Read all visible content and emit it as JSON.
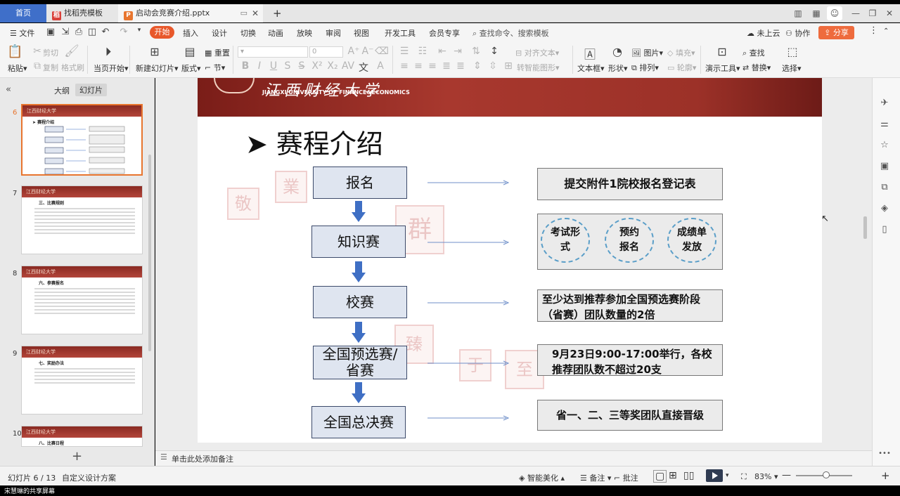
{
  "tabs": {
    "home": "首页",
    "template": "找稻壳模板",
    "doc": "启动会竞赛介绍.pptx",
    "add": "+"
  },
  "menu": {
    "file": "文件",
    "items": [
      "开始",
      "插入",
      "设计",
      "切换",
      "动画",
      "放映",
      "审阅",
      "视图",
      "开发工具",
      "会员专享"
    ],
    "search": "查找命令、搜索模板",
    "cloud": "未上云",
    "collab": "协作",
    "share": "分享"
  },
  "ribbon": {
    "paste": "粘贴",
    "cut": "剪切",
    "copy": "复制",
    "format_painter": "格式刷",
    "from_current": "当页开始",
    "new_slide": "新建幻灯片",
    "layout": "版式",
    "reset": "重置",
    "section": "节",
    "font_size": "0",
    "align_text": "对齐文本",
    "smart_shape": "转智能图形",
    "textbox": "文本框",
    "shape": "形状",
    "picture": "图片",
    "arrange": "排列",
    "fill": "填充",
    "outline": "轮廓",
    "present_tools": "演示工具",
    "find": "查找",
    "replace": "替换",
    "select": "选择"
  },
  "left_panel": {
    "outline_tab": "大纲",
    "slides_tab": "幻灯片",
    "slide_numbers": [
      "6",
      "7",
      "8",
      "9",
      "10"
    ],
    "thumb_titles": [
      "赛程介绍",
      "三、比赛规则",
      "六、参赛报名",
      "七、奖励办法",
      "八、比赛日程"
    ],
    "thumb_header": "江西财经大学"
  },
  "slide": {
    "banner_cn": "江西财经大学",
    "banner_en": "JIANGXI UNIVERSITY OF FINANCE&ECONOMICS",
    "title": "➤ 赛程介绍",
    "watermarks": [
      "敬",
      "業",
      "群",
      "臻",
      "至",
      "于"
    ],
    "steps": [
      "报名",
      "知识赛",
      "校赛",
      "全国预选赛/\n省赛",
      "全国总决赛"
    ],
    "details": {
      "signup": "提交附件1院校报名登记表",
      "knowledge_circles": [
        "考试形\n式",
        "预约\n报名",
        "成绩单\n发放"
      ],
      "school": "至少达到推荐参加全国预选赛阶段（省赛）团队数量的2倍",
      "provincial": "9月23日9:00-17:00举行，各校推荐团队数不超过20支",
      "final": "省一、二、三等奖团队直接晋级"
    }
  },
  "notes_placeholder": "单击此处添加备注",
  "status": {
    "slide_counter": "幻灯片 6 / 13",
    "design": "自定义设计方案",
    "beautify": "智能美化",
    "notes": "备注",
    "comments": "批注",
    "zoom": "83%"
  },
  "screen_share_label": "宋慧琳的共享屏幕",
  "colors": {
    "accent": "#e8582b",
    "banner_red": "#a8382e",
    "box_fill": "#dfe5f0",
    "arrow_blue": "#3f6fc4"
  }
}
